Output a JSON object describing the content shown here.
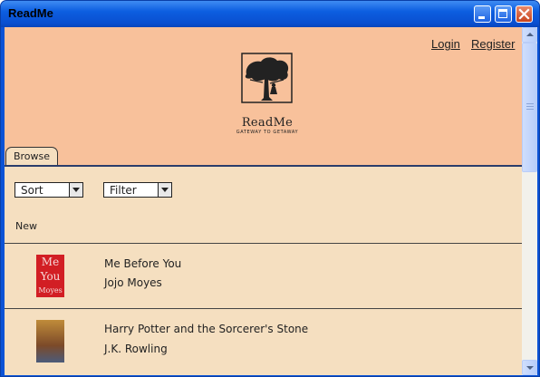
{
  "window": {
    "title": "ReadMe"
  },
  "header": {
    "login_label": "Login",
    "register_label": "Register",
    "brand": "ReadMe",
    "tagline": "GATEWAY TO GETAWAY"
  },
  "tabs": [
    {
      "label": "Browse"
    }
  ],
  "controls": {
    "sort": {
      "value": "Sort"
    },
    "filter": {
      "value": "Filter"
    }
  },
  "section_label": "New",
  "books": [
    {
      "title": "Me Before You",
      "author": "Jojo Moyes",
      "cover_text": [
        "Me",
        "You",
        "Moyes"
      ],
      "cover_color": "#d21e24"
    },
    {
      "title": "Harry Potter and the Sorcerer's Stone",
      "author": "J.K. Rowling",
      "cover_color": "#8a5a30"
    }
  ],
  "colors": {
    "header_bg": "#f8c19b",
    "content_bg": "#f5dfc0",
    "titlebar": "#0b53d6"
  },
  "icons": [
    "minimize-icon",
    "maximize-icon",
    "close-icon",
    "tree-logo-icon",
    "dropdown-arrow-icon",
    "scroll-up-icon",
    "scroll-down-icon"
  ]
}
